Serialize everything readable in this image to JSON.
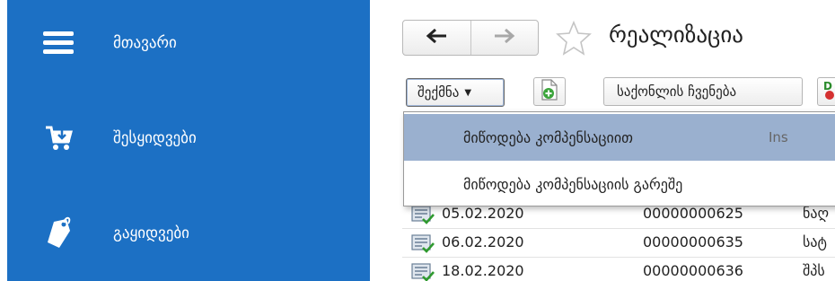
{
  "sidebar": {
    "items": [
      {
        "label": "მთავარი",
        "icon": "hamburger-menu-icon"
      },
      {
        "label": "შესყიდვები",
        "icon": "cart-icon"
      },
      {
        "label": "გაყიდვები",
        "icon": "price-tag-icon"
      }
    ],
    "background": "#1c70c4"
  },
  "header": {
    "title": "რეალიზაცია",
    "back_icon": "arrow-left-icon",
    "forward_icon": "arrow-right-icon",
    "favorite_icon": "star-icon"
  },
  "toolbar": {
    "create_label": "შექმნა",
    "create_dropdown_icon": "caret-down-icon",
    "add_document_icon": "add-document-icon",
    "show_goods_label": "საქონლის ჩვენება",
    "extra_icon": "document-delete-icon"
  },
  "create_menu": {
    "items": [
      {
        "label": "მიწოდება კომპენსაციით",
        "shortcut": "Ins",
        "highlighted": true
      },
      {
        "label": "მიწოდება კომპენსაციის გარეშე",
        "shortcut": "",
        "highlighted": false
      }
    ],
    "highlight_color": "#9ab0cf"
  },
  "table": {
    "rows": [
      {
        "date": "05.02.2020",
        "number": "00000000625",
        "name": "ნაღ"
      },
      {
        "date": "06.02.2020",
        "number": "00000000635",
        "name": "სატ"
      },
      {
        "date": "18.02.2020",
        "number": "00000000636",
        "name": "შპს"
      }
    ]
  }
}
